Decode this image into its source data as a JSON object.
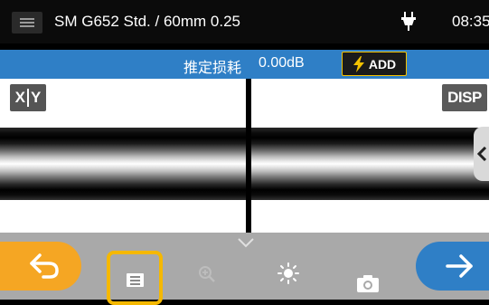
{
  "status_bar": {
    "title": "SM G652 Std. / 60mm 0.25",
    "time": "08:35",
    "power_icon": "plug-icon",
    "menu_icon": "hamburger-menu-icon"
  },
  "info_bar": {
    "loss_label": "推定损耗",
    "loss_value": "0.00dB",
    "add_label": "ADD",
    "add_icon": "lightning-icon"
  },
  "view": {
    "xy_label_x": "X",
    "xy_label_y": "Y",
    "disp_label": "DISP"
  },
  "toolbar": {
    "back_icon": "back-arrow-icon",
    "memo_icon": "memo-icon",
    "zoom_icon": "zoom-in-icon",
    "expand_icon": "chevron-down-icon",
    "brightness_icon": "brightness-icon",
    "camera_icon": "camera-icon",
    "next_icon": "forward-arrow-icon"
  },
  "colors": {
    "info_bar": "#2f7fc6",
    "back_button": "#f5a623",
    "memo_highlight": "#f5b800",
    "next_button": "#2f7fc6",
    "toolbar": "#a9a9a9"
  }
}
